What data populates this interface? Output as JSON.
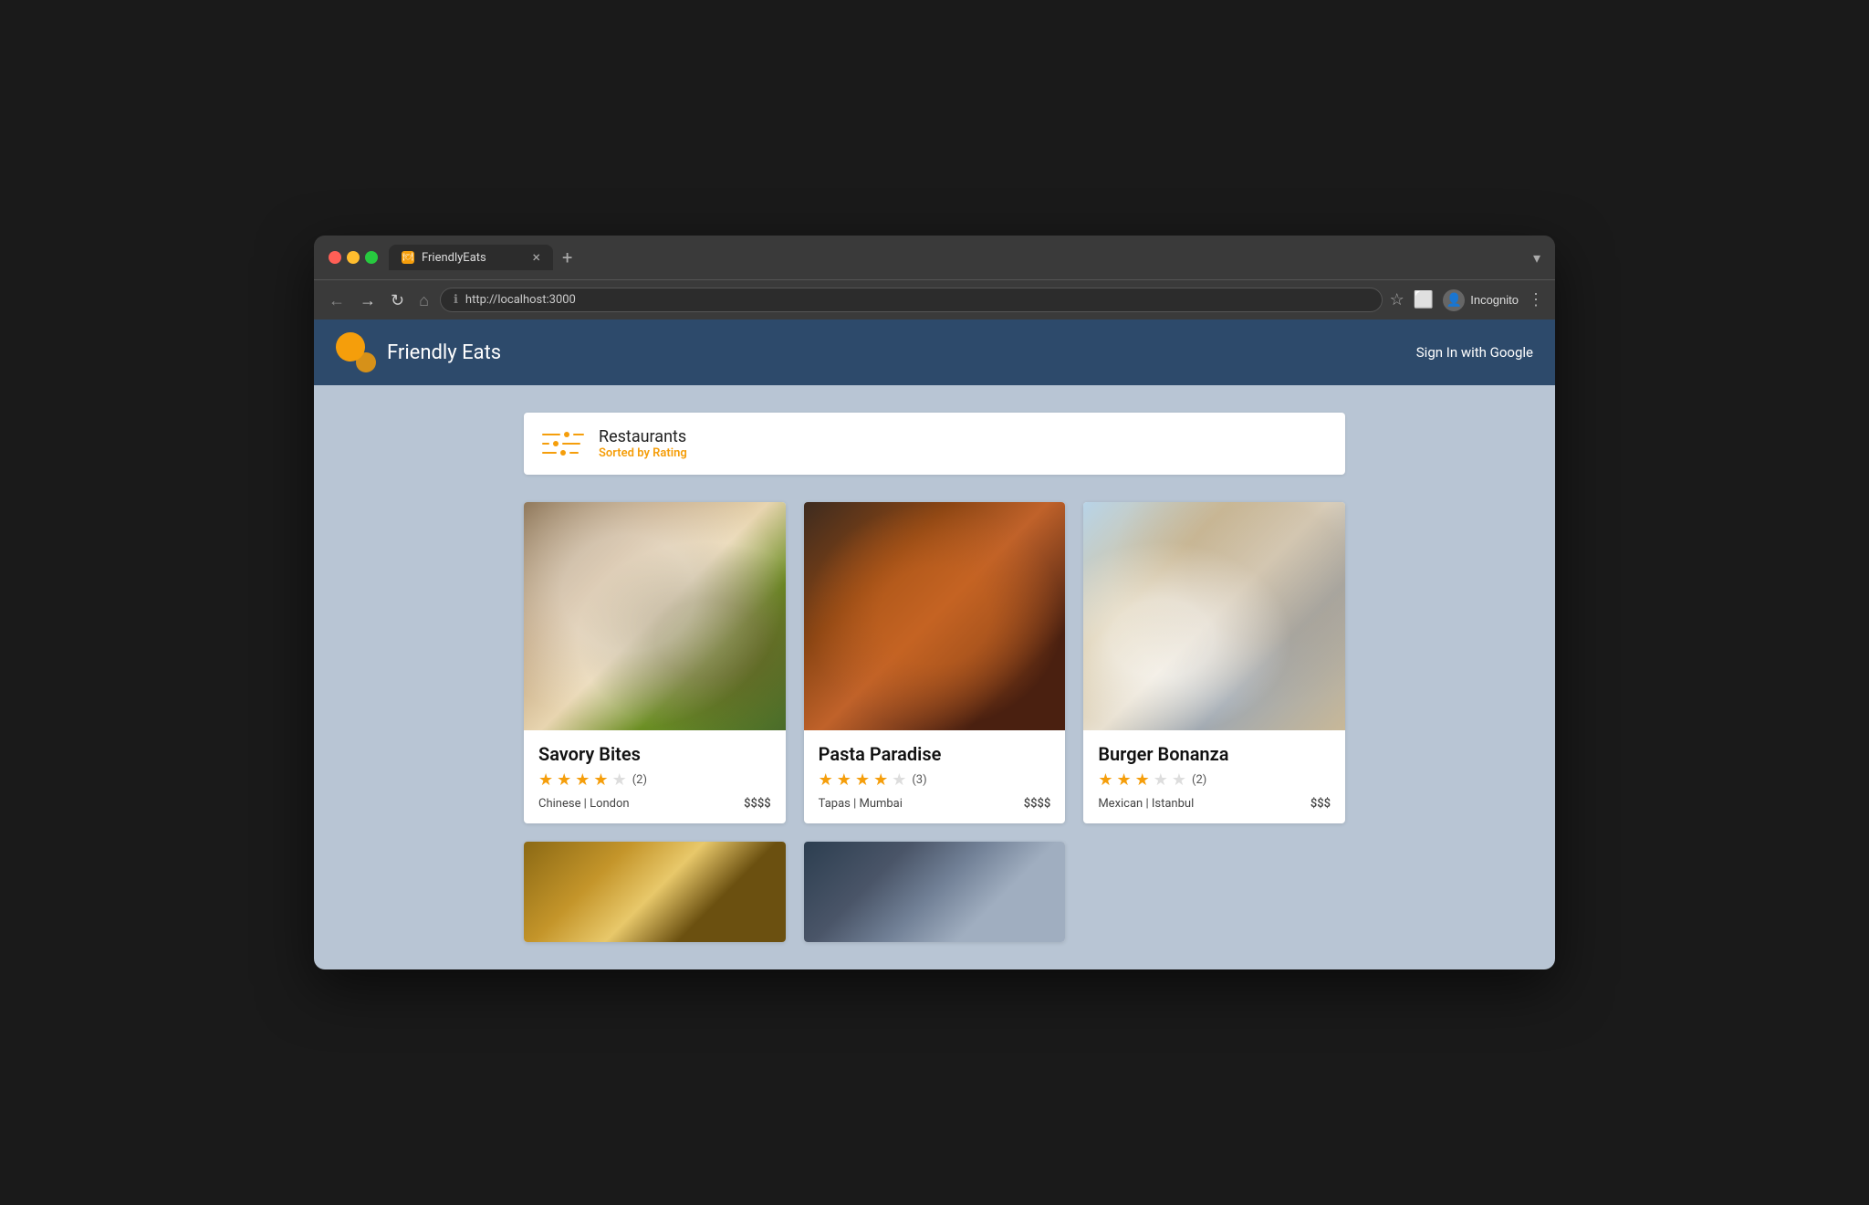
{
  "browser": {
    "tab": {
      "title": "FriendlyEats",
      "favicon": "🍽"
    },
    "url": "http://localhost:3000",
    "nav": {
      "back": "←",
      "forward": "→",
      "refresh": "↻",
      "home": "⌂"
    },
    "actions": {
      "star": "☆",
      "split_screen": "⬜",
      "incognito_label": "Incognito",
      "menu": "⋮",
      "new_tab": "+",
      "tab_dropdown": "▾"
    }
  },
  "app": {
    "title": "Friendly Eats",
    "sign_in_label": "Sign In with Google"
  },
  "page": {
    "header": {
      "title": "Restaurants",
      "sorted_label": "Sorted by Rating"
    },
    "restaurants": [
      {
        "id": 1,
        "name": "Savory Bites",
        "cuisine": "Chinese",
        "location": "London",
        "price": "$$$$",
        "rating": 3.5,
        "stars": [
          true,
          true,
          true,
          true,
          false
        ],
        "half_star": true,
        "review_count": 2,
        "img_class": "card-img-1"
      },
      {
        "id": 2,
        "name": "Pasta Paradise",
        "cuisine": "Tapas",
        "location": "Mumbai",
        "price": "$$$$",
        "rating": 3.5,
        "stars": [
          true,
          true,
          true,
          true,
          false
        ],
        "review_count": 3,
        "img_class": "card-img-2"
      },
      {
        "id": 3,
        "name": "Burger Bonanza",
        "cuisine": "Mexican",
        "location": "Istanbul",
        "price": "$$$",
        "rating": 3.0,
        "stars": [
          true,
          true,
          true,
          false,
          false
        ],
        "review_count": 2,
        "img_class": "card-img-3"
      }
    ],
    "restaurants_row2": [
      {
        "id": 4,
        "img_class": "card-img-4"
      },
      {
        "id": 5,
        "img_class": "card-img-5"
      }
    ],
    "star_filled": "★",
    "star_empty": "★"
  }
}
